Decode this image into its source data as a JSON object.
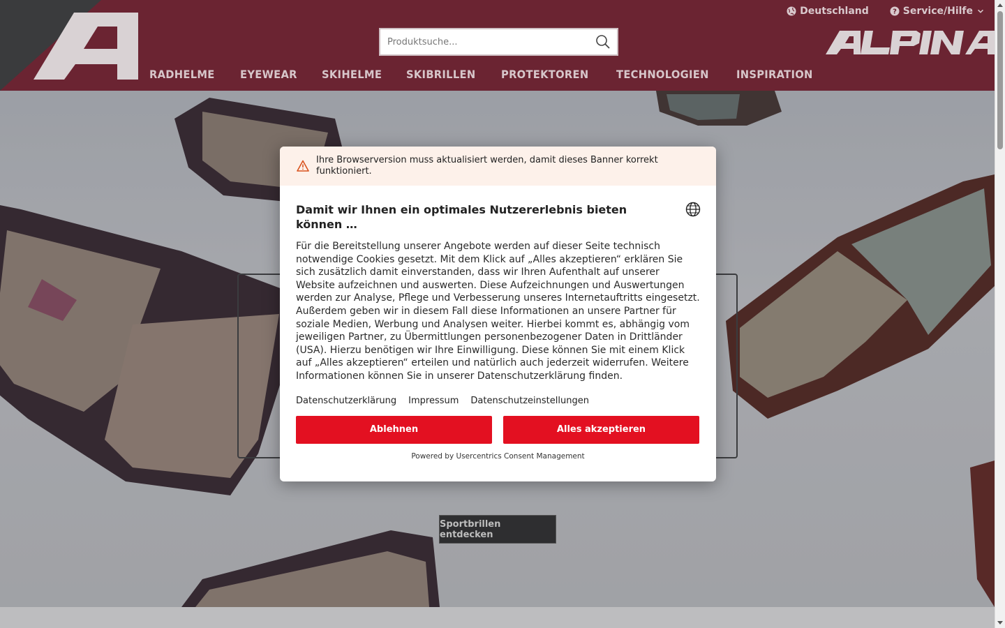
{
  "header": {
    "topbar": {
      "country_label": "Deutschland",
      "service_label": "Service/Hilfe"
    },
    "search": {
      "placeholder": "Produktsuche..."
    },
    "brand": "ALPINA",
    "nav": [
      "RADHELME",
      "EYEWEAR",
      "SKIHELME",
      "SKIBRILLEN",
      "PROTEKTOREN",
      "TECHNOLOGIEN",
      "INSPIRATION"
    ]
  },
  "hero": {
    "cta_label": "Sportbrillen entdecken"
  },
  "consent": {
    "warning": "Ihre Browserversion muss aktualisiert werden, damit dieses Banner korrekt funktioniert.",
    "title": "Damit wir Ihnen ein optimales Nutzererlebnis bieten können …",
    "text": "Für die Bereitstellung unserer Angebote werden auf dieser Seite technisch notwendige Cookies gesetzt. Mit dem Klick auf „Alles akzeptieren“ erklären Sie sich zusätzlich damit einverstanden, dass wir Ihren Aufenthalt auf unserer Website aufzeichnen und auswerten. Diese Aufzeichnungen und Auswertungen werden zur Analyse, Pflege und Verbesserung unseres Internetauftritts eingesetzt. Außerdem geben wir in diesem Fall diese Informationen an unsere Partner für soziale Medien, Werbung und Analysen weiter. Hierbei kommt es, abhängig vom jeweiligen Partner, zu Übermittlungen personenbezogener Daten in Drittländer (USA). Hierzu benötigen wir Ihre Einwilligung. Diese können Sie mit einem Klick auf „Alles akzeptieren“ erteilen und natürlich auch jederzeit widerrufen. Weitere Informationen können Sie in unserer Datenschutzerklärung finden.",
    "links": {
      "privacy": "Datenschutzerklärung",
      "imprint": "Impressum",
      "settings": "Datenschutzeinstellungen"
    },
    "decline_label": "Ablehnen",
    "accept_label": "Alles akzeptieren",
    "powered_by": "Powered by Usercentrics Consent Management"
  },
  "colors": {
    "header_bg": "#6b2432",
    "accent_red": "#e31021",
    "warning_bg": "#fdf1ea"
  }
}
